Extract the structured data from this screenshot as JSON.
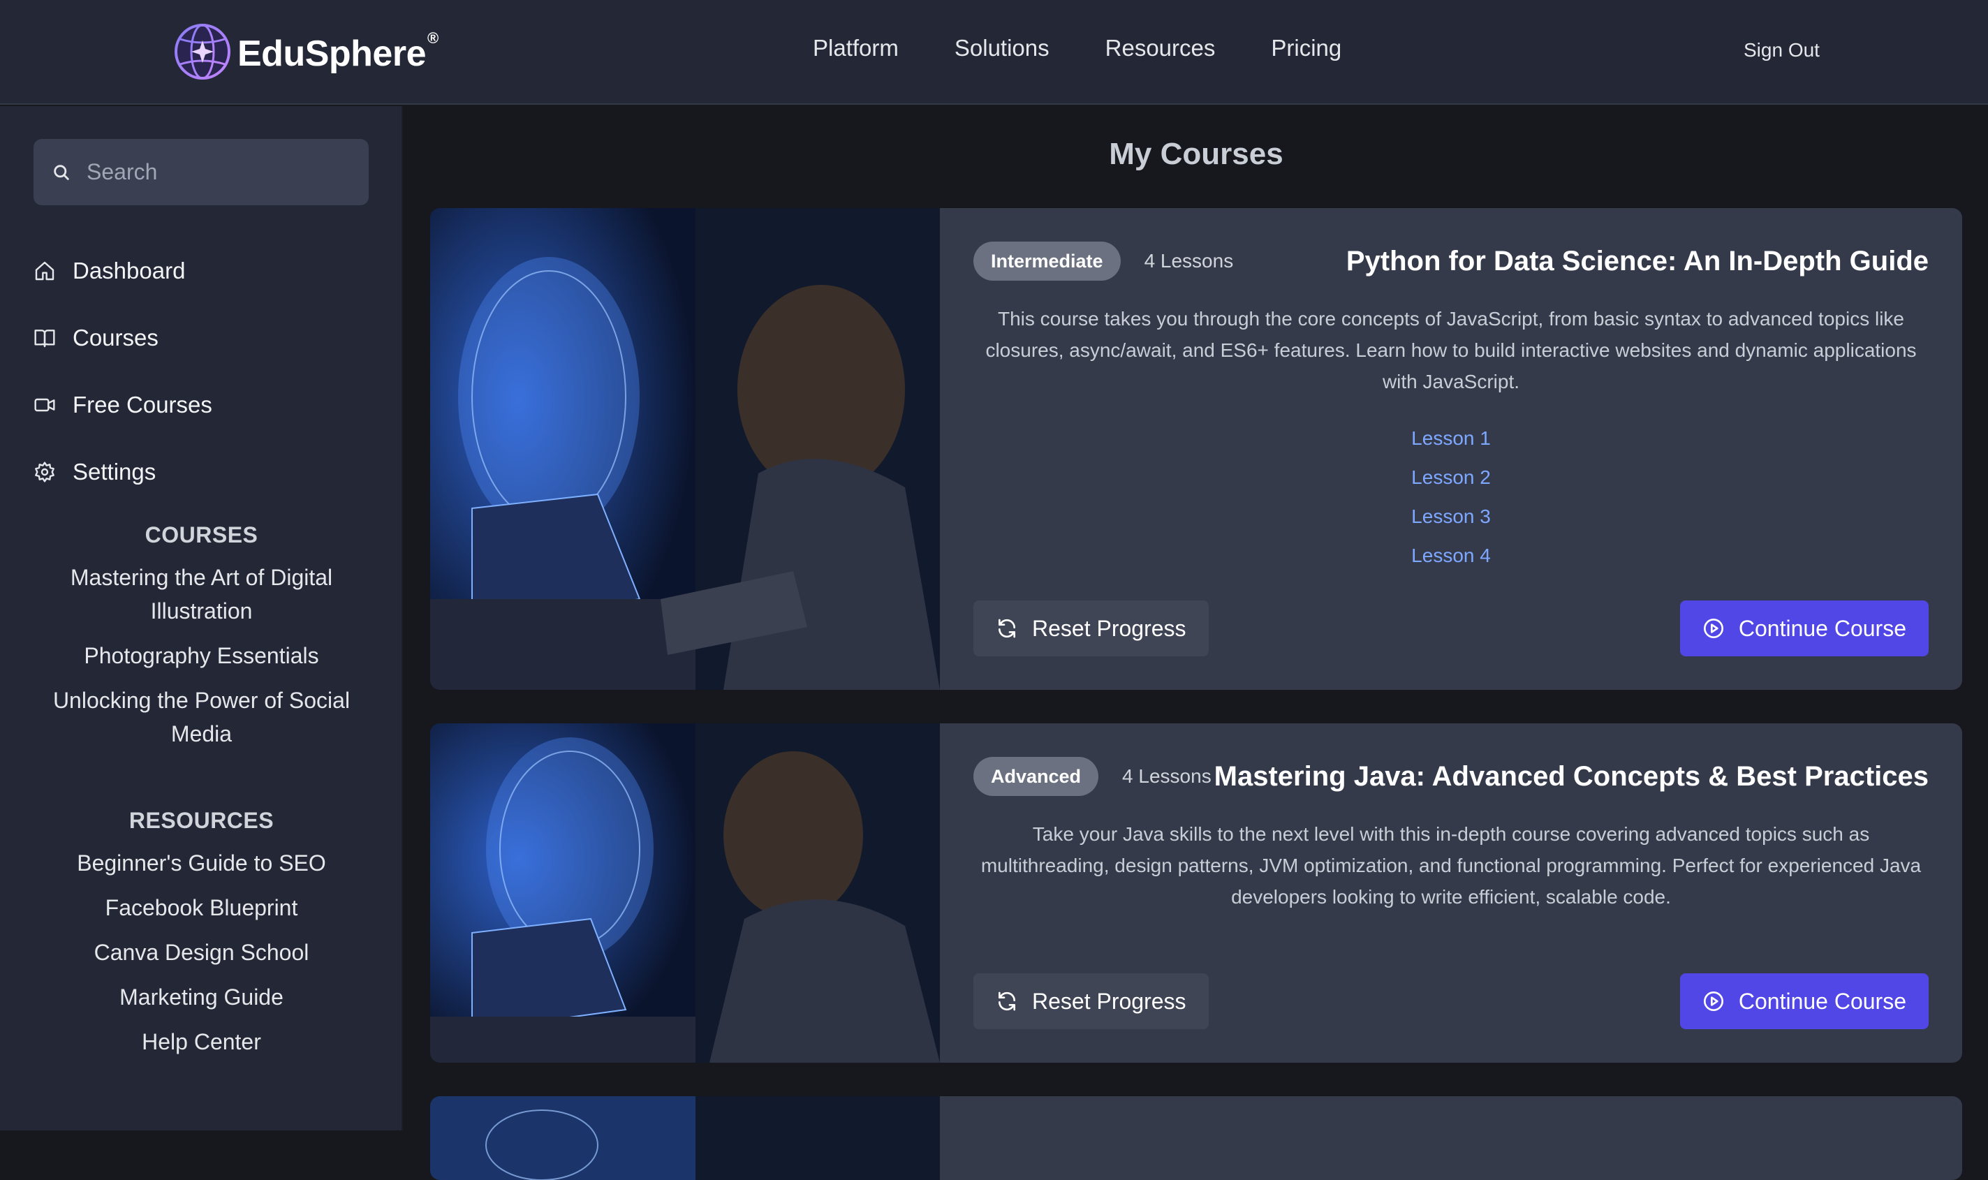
{
  "app": {
    "brand": "EduSphere",
    "brand_mark": "®"
  },
  "topnav": {
    "items": [
      "Platform",
      "Solutions",
      "Resources",
      "Pricing"
    ],
    "sign_out": "Sign Out"
  },
  "sidebar": {
    "search_placeholder": "Search",
    "nav": [
      {
        "label": "Dashboard",
        "icon": "home-icon"
      },
      {
        "label": "Courses",
        "icon": "book-icon"
      },
      {
        "label": "Free Courses",
        "icon": "video-icon"
      },
      {
        "label": "Settings",
        "icon": "gear-icon"
      }
    ],
    "courses_heading": "COURSES",
    "courses": [
      "Mastering the Art of Digital Illustration",
      "Photography Essentials",
      "Unlocking the Power of Social Media"
    ],
    "resources_heading": "RESOURCES",
    "resources": [
      "Beginner's Guide to SEO",
      "Facebook Blueprint",
      "Canva Design School",
      "Marketing Guide",
      "Help Center"
    ]
  },
  "main": {
    "title": "My Courses",
    "courses": [
      {
        "level": "Intermediate",
        "lessons_count": "4 Lessons",
        "title": "Python for Data Science: An In-Depth Guide",
        "description": "This course takes you through the core concepts of JavaScript, from basic syntax to advanced topics like closures, async/await, and ES6+ features. Learn how to build interactive websites and dynamic applications with JavaScript.",
        "lessons": [
          "Lesson 1",
          "Lesson 2",
          "Lesson 3",
          "Lesson 4"
        ],
        "reset_label": "Reset Progress",
        "continue_label": "Continue Course"
      },
      {
        "level": "Advanced",
        "lessons_count": "4 Lessons",
        "title": "Mastering Java: Advanced Concepts & Best Practices",
        "description": "Take your Java skills to the next level with this in-depth course covering advanced topics such as multithreading, design patterns, JVM optimization, and functional programming. Perfect for experienced Java developers looking to write efficient, scalable code.",
        "lessons": [],
        "reset_label": "Reset Progress",
        "continue_label": "Continue Course"
      }
    ]
  },
  "colors": {
    "accent": "#5146e6",
    "link": "#7ea8ff",
    "card_bg": "#353a4b",
    "sidebar_bg": "#242836"
  }
}
